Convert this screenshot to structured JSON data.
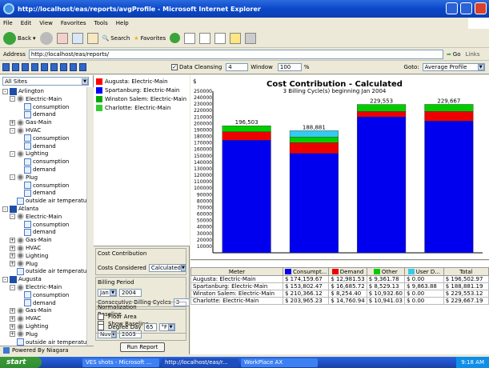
{
  "window": {
    "title": "http://localhost/eas/reports/avgProfile - Microsoft Internet Explorer"
  },
  "menu": [
    "File",
    "Edit",
    "View",
    "Favorites",
    "Tools",
    "Help"
  ],
  "toolbar": {
    "back": "Back",
    "search": "Search",
    "favorites": "Favorites"
  },
  "address": {
    "label": "Address",
    "url": "http://localhost/eas/reports/",
    "go": "Go",
    "links": "Links"
  },
  "appbar": {
    "data_cleansing": "Data Cleansing",
    "window_value": "4",
    "window_label": "Window",
    "pct_value": "100",
    "pct_label": "%",
    "goto_label": "Goto:",
    "goto_value": "Average Profile"
  },
  "sites": {
    "selected": "All Sites"
  },
  "tree": [
    {
      "label": "Arlington",
      "type": "site",
      "level": 0,
      "exp": "-"
    },
    {
      "label": "Electric-Main",
      "type": "gear",
      "level": 1,
      "exp": "-"
    },
    {
      "label": "consumption",
      "type": "pt",
      "level": 2,
      "exp": ""
    },
    {
      "label": "demand",
      "type": "pt",
      "level": 2,
      "exp": ""
    },
    {
      "label": "Gas-Main",
      "type": "gear",
      "level": 1,
      "exp": "+"
    },
    {
      "label": "HVAC",
      "type": "gear",
      "level": 1,
      "exp": "-"
    },
    {
      "label": "consumption",
      "type": "pt",
      "level": 2,
      "exp": ""
    },
    {
      "label": "demand",
      "type": "pt",
      "level": 2,
      "exp": ""
    },
    {
      "label": "Lighting",
      "type": "gear",
      "level": 1,
      "exp": "-"
    },
    {
      "label": "consumption",
      "type": "pt",
      "level": 2,
      "exp": ""
    },
    {
      "label": "demand",
      "type": "pt",
      "level": 2,
      "exp": ""
    },
    {
      "label": "Plug",
      "type": "gear",
      "level": 1,
      "exp": "-"
    },
    {
      "label": "consumption",
      "type": "pt",
      "level": 2,
      "exp": ""
    },
    {
      "label": "demand",
      "type": "pt",
      "level": 2,
      "exp": ""
    },
    {
      "label": "outside air temperatu",
      "type": "pt",
      "level": 1,
      "exp": ""
    },
    {
      "label": "Atlanta",
      "type": "site",
      "level": 0,
      "exp": "-"
    },
    {
      "label": "Electric-Main",
      "type": "gear",
      "level": 1,
      "exp": "-"
    },
    {
      "label": "consumption",
      "type": "pt",
      "level": 2,
      "exp": ""
    },
    {
      "label": "demand",
      "type": "pt",
      "level": 2,
      "exp": ""
    },
    {
      "label": "Gas-Main",
      "type": "gear",
      "level": 1,
      "exp": "+"
    },
    {
      "label": "HVAC",
      "type": "gear",
      "level": 1,
      "exp": "+"
    },
    {
      "label": "Lighting",
      "type": "gear",
      "level": 1,
      "exp": "+"
    },
    {
      "label": "Plug",
      "type": "gear",
      "level": 1,
      "exp": "+"
    },
    {
      "label": "outside air temperatu",
      "type": "pt",
      "level": 1,
      "exp": ""
    },
    {
      "label": "Augusta",
      "type": "site",
      "level": 0,
      "exp": "-"
    },
    {
      "label": "Electric-Main",
      "type": "gear",
      "level": 1,
      "exp": "-"
    },
    {
      "label": "consumption",
      "type": "pt",
      "level": 2,
      "exp": ""
    },
    {
      "label": "demand",
      "type": "pt",
      "level": 2,
      "exp": ""
    },
    {
      "label": "Gas-Main",
      "type": "gear",
      "level": 1,
      "exp": "+"
    },
    {
      "label": "HVAC",
      "type": "gear",
      "level": 1,
      "exp": "+"
    },
    {
      "label": "Lighting",
      "type": "gear",
      "level": 1,
      "exp": "+"
    },
    {
      "label": "Plug",
      "type": "gear",
      "level": 1,
      "exp": "+"
    },
    {
      "label": "outside air temperatu",
      "type": "pt",
      "level": 1,
      "exp": ""
    }
  ],
  "legend": [
    {
      "label": "Augusta: Electric-Main",
      "color": "#ff0000"
    },
    {
      "label": "Spartanburg: Electric-Main",
      "color": "#0000ff"
    },
    {
      "label": "Winston Salem: Electric-Main",
      "color": "#00aa00"
    },
    {
      "label": "Charlotte: Electric-Main",
      "color": "#33cc33"
    }
  ],
  "controls": {
    "cost_contribution": "Cost Contribution",
    "costs_considered_label": "Costs Considered",
    "costs_considered_value": "Calculated",
    "billing_period": "Billing Period",
    "billing_month": "Jan",
    "billing_year": "2004",
    "consecutive_label": "Consecutive Billing Cycles",
    "consecutive_value": "3",
    "baseline": "Baseline",
    "show_baseline": "Show Baseline",
    "baseline_month": "Nov",
    "baseline_year": "2003",
    "normalization": "Normalization",
    "floor_area": "Floor Area",
    "degree_day": "Degree Day",
    "degree_value": "65",
    "degree_unit": "°F",
    "run": "Run Report"
  },
  "chart_data": {
    "type": "bar",
    "title": "Cost Contribution - Calculated",
    "subtitle": "3 Billing Cycle(s) beginning Jan 2004",
    "ylabel": "$",
    "ylim": [
      0,
      250000
    ],
    "ytick_step": 10000,
    "categories": [
      "Augusta: Electric-Main",
      "Spartanburg: Electric-Main",
      "Winston Salem: Electric-Main",
      "Charlotte: Electric-Main"
    ],
    "totals_labels": [
      "196,503",
      "188,881",
      "229,553",
      "229,667"
    ],
    "series": [
      {
        "name": "Consumption",
        "color": "#0000ee",
        "values": [
          174159.67,
          153802.47,
          210366.12,
          203965.23
        ]
      },
      {
        "name": "Demand",
        "color": "#ee0000",
        "values": [
          12981.53,
          16685.72,
          8254.4,
          14760.94
        ]
      },
      {
        "name": "Other",
        "color": "#00cc00",
        "values": [
          9361.78,
          8529.13,
          10932.6,
          10941.03
        ]
      },
      {
        "name": "User D...",
        "color": "#33ccee",
        "values": [
          0,
          9863.88,
          0,
          0
        ]
      }
    ]
  },
  "table": {
    "headers": [
      "Meter",
      "Consumpt...",
      "Demand",
      "Other",
      "User D...",
      "Total"
    ],
    "header_colors": [
      "",
      "#0000ee",
      "#ee0000",
      "#00cc00",
      "#33ccee",
      ""
    ],
    "rows": [
      [
        "Augusta: Electric-Main",
        "$ 174,159.67",
        "$ 12,981.53",
        "$ 9,361.78",
        "$ 0.00",
        "$ 196,502.97"
      ],
      [
        "Spartanburg: Electric-Main",
        "$ 153,802.47",
        "$ 16,685.72",
        "$ 8,529.13",
        "$ 9,863.88",
        "$ 188,881.19"
      ],
      [
        "Winston Salem: Electric-Main",
        "$ 210,366.12",
        "$ 8,254.40",
        "$ 10,932.60",
        "$ 0.00",
        "$ 229,553.12"
      ],
      [
        "Charlotte: Electric-Main",
        "$ 203,965.23",
        "$ 14,760.94",
        "$ 10,941.03",
        "$ 0.00",
        "$ 229,667.19"
      ]
    ]
  },
  "footer": {
    "powered": "Powered By Niagara"
  },
  "taskbar": {
    "start": "start",
    "tasks": [
      "VES shots - Microsoft ...",
      "http://localhost/eas/r...",
      "WorkPlace AX"
    ],
    "clock": "9:18 AM"
  }
}
